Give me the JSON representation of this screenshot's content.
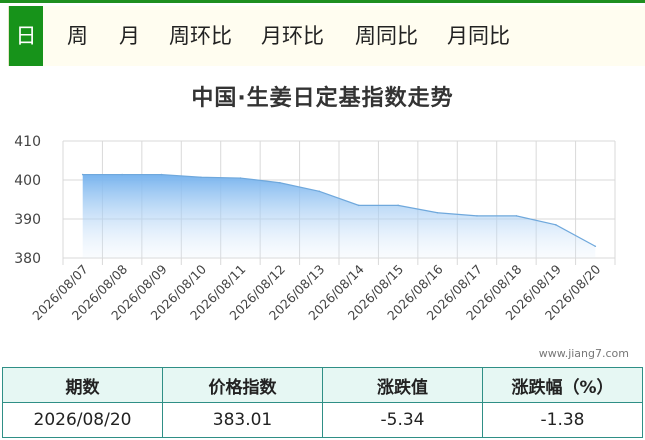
{
  "tabs": [
    {
      "label": "日",
      "active": true
    },
    {
      "label": "周",
      "active": false
    },
    {
      "label": "月",
      "active": false
    },
    {
      "label": "周环比",
      "active": false
    },
    {
      "label": "月环比",
      "active": false
    },
    {
      "label": "周同比",
      "active": false
    },
    {
      "label": "月同比",
      "active": false
    }
  ],
  "chart_title": "中国·生姜日定基指数走势",
  "watermark": "www.jiang7.com",
  "colors": {
    "accent": "#17931a",
    "area_top": "#79b4ee",
    "line": "#6fa8dc",
    "table_header": "#e6f7f3",
    "table_border": "#2f8f86"
  },
  "chart_data": {
    "type": "area",
    "title": "中国·生姜日定基指数走势",
    "x": [
      "2026/08/07",
      "2026/08/08",
      "2026/08/09",
      "2026/08/10",
      "2026/08/11",
      "2026/08/12",
      "2026/08/13",
      "2026/08/14",
      "2026/08/15",
      "2026/08/16",
      "2026/08/17",
      "2026/08/18",
      "2026/08/19",
      "2026/08/20"
    ],
    "values": [
      401.4,
      401.4,
      401.4,
      400.7,
      400.5,
      399.3,
      397.1,
      393.5,
      393.5,
      391.6,
      390.8,
      390.8,
      388.5,
      383.01
    ],
    "ylim": [
      380,
      410
    ],
    "yticks": [
      "380",
      "390",
      "400",
      "410"
    ],
    "grid": true,
    "xlabel": "",
    "ylabel": ""
  },
  "table": {
    "headers": [
      "期数",
      "价格指数",
      "涨跌值",
      "涨跌幅（%）"
    ],
    "row": [
      "2026/08/20",
      "383.01",
      "-5.34",
      "-1.38"
    ]
  }
}
